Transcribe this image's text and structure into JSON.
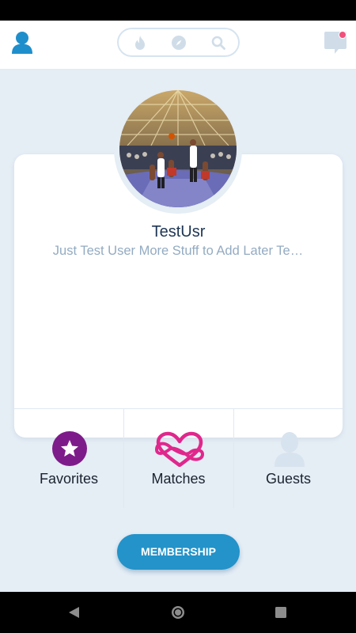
{
  "header": {
    "profile_icon": "user-icon",
    "nav_icons": [
      "flame-icon",
      "compass-icon",
      "search-icon"
    ],
    "chat_icon": "chat-bubble-icon",
    "has_notification": true
  },
  "profile": {
    "username": "TestUsr",
    "bio": "Just Test User More Stuff to Add Later Te…",
    "avatar_description": "avatar-photo"
  },
  "stats": {
    "favorites_label": "Favorites",
    "matches_label": "Matches",
    "guests_label": "Guests"
  },
  "membership_label": "MEMBERSHIP",
  "colors": {
    "accent_blue": "#2393c9",
    "favorites_purple": "#7e1b8a",
    "matches_pink": "#e0278c",
    "background": "#e5edf5",
    "notification": "#f0507a"
  }
}
